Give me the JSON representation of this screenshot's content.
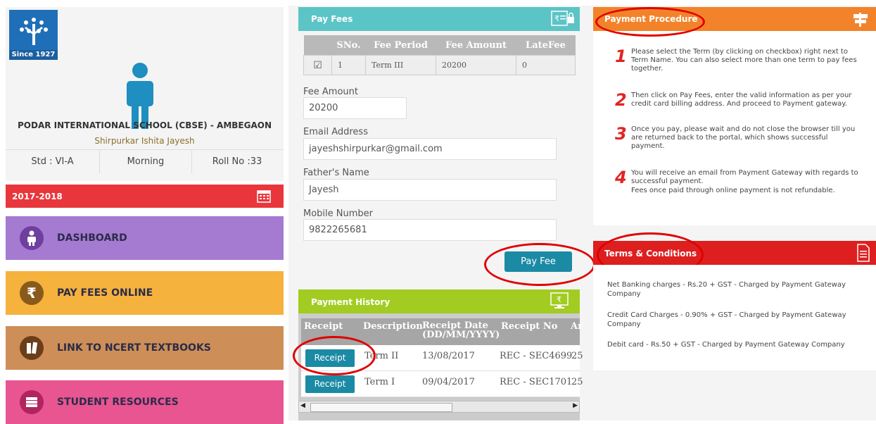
{
  "school": {
    "logo_text": "Since 1927",
    "name": "PODAR INTERNATIONAL SCHOOL (CBSE) - AMBEGAON",
    "student": "Shirpurkar Ishita Jayesh",
    "std": "Std : VI-A",
    "shift": "Morning",
    "roll": "Roll No :33"
  },
  "year": "2017-2018",
  "menu": {
    "dashboard": "DASHBOARD",
    "pay": "PAY FEES ONLINE",
    "ncert": "LINK TO NCERT TEXTBOOKS",
    "resources": "STUDENT RESOURCES"
  },
  "payfees": {
    "title": "Pay Fees",
    "table": {
      "headers": [
        "SNo.",
        "Fee Period",
        "Fee Amount",
        "LateFee"
      ],
      "row": {
        "checked": "☑",
        "sno": "1",
        "period": "Term III",
        "amount": "20200",
        "late": "0"
      }
    },
    "fee_amount_label": "Fee Amount",
    "fee_amount": "20200",
    "email_label": "Email Address",
    "email": "jayeshshirpurkar@gmail.com",
    "father_label": "Father's Name",
    "father": "Jayesh",
    "mobile_label": "Mobile Number",
    "mobile": "9822265681",
    "button": "Pay Fee"
  },
  "history": {
    "title": "Payment History",
    "headers": {
      "receipt": "Receipt",
      "desc": "Description",
      "date": "Receipt Date (DD/MM/YYYY)",
      "no": "Receipt No",
      "amt": "Ar"
    },
    "rows": [
      {
        "btn": "Receipt",
        "desc": "Term II",
        "date": "13/08/2017",
        "no": "REC - SEC4699",
        "amt": "25"
      },
      {
        "btn": "Receipt",
        "desc": "Term I",
        "date": "09/04/2017",
        "no": "REC - SEC1701",
        "amt": "25"
      }
    ]
  },
  "procedure": {
    "title": "Payment Procedure",
    "steps": [
      {
        "n": "1",
        "text": "Please select the Term (by clicking on checkbox) right next to Term Name. You can also select more than one term to pay fees together."
      },
      {
        "n": "2",
        "text": "Then click on Pay Fees, enter the valid information as per your credit card billing address. And proceed to Payment gateway."
      },
      {
        "n": "3",
        "text": "Once you pay, please wait and do not close the browser till you are returned back to the portal, which shows successful payment."
      },
      {
        "n": "4",
        "text": "You will receive an email from Payment Gateway with regards to successful payment.",
        "text2": "Fees once paid through online payment is not refundable."
      }
    ]
  },
  "terms": {
    "title": "Terms & Conditions",
    "items": [
      "Net Banking charges - Rs.20 + GST - Charged by Payment Gateway Company",
      "Credit Card Charges - 0.90% + GST - Charged by Payment Gateway Company",
      "Debit card - Rs.50 + GST - Charged by Payment Gateway Company"
    ]
  },
  "colors": {
    "accent_red": "#e10000",
    "teal": "#1b8aa4"
  }
}
